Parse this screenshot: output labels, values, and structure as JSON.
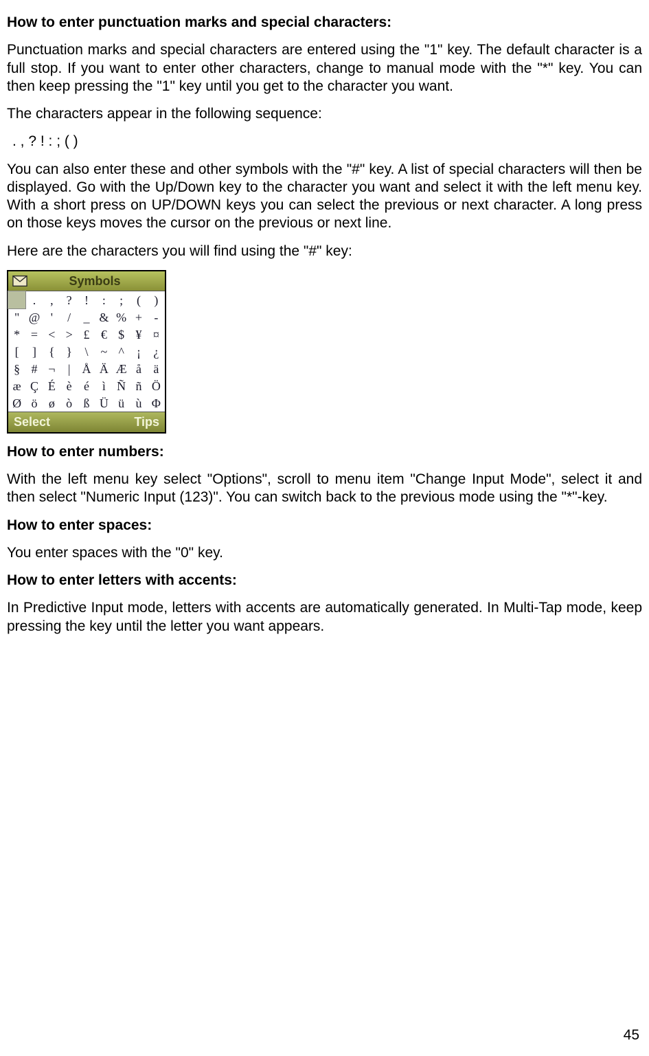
{
  "sections": {
    "punct_heading": "How to enter punctuation marks and special characters:",
    "punct_para1": "Punctuation marks and special characters are entered using the \"1\" key. The default character is a full stop. If you want to enter other characters, change to manual mode with the \"*\" key. You can then keep pressing the \"1\" key until you get to the character you want.",
    "seq_intro": "The characters appear in the following sequence:",
    "seq": ". , ? ! : ; ( )",
    "punct_para2": "You can also enter these and other symbols with the \"#\" key. A list of special characters will then be displayed. Go with the Up/Down key to the character you want and select it with the left menu key. With a short press on UP/DOWN keys you can select the previous or next character. A long press on those keys moves the cursor on the previous or next line.",
    "hash_intro": "Here are the characters you will find using the \"#\" key:",
    "numbers_heading": "How to enter numbers:",
    "numbers_para": "With the left menu key select \"Options\", scroll to menu item \"Change Input Mode\", select it and then select \"Numeric Input (123)\". You can switch back to the previous mode using the \"*\"-key.",
    "spaces_heading": "How to enter spaces:",
    "spaces_para": "You enter spaces with the \"0\" key.",
    "accents_heading": "How to enter letters with accents:",
    "accents_para": "In Predictive Input mode, letters with accents are automatically generated. In Multi-Tap mode, keep pressing the key until the letter you want appears."
  },
  "phone": {
    "title": "Symbols",
    "softkeys": {
      "left": "Select",
      "right": "Tips"
    },
    "grid": [
      [
        "",
        ".",
        ",",
        "?",
        "!",
        ":",
        ";",
        "(",
        ")"
      ],
      [
        "\"",
        "@",
        "'",
        "/",
        "_",
        "&",
        "%",
        "+",
        "-"
      ],
      [
        "*",
        "=",
        "<",
        ">",
        "£",
        "€",
        "$",
        "¥",
        "¤"
      ],
      [
        "[",
        "]",
        "{",
        "}",
        "\\",
        "~",
        "^",
        "¡",
        "¿"
      ],
      [
        "§",
        "#",
        "¬",
        "|",
        "Å",
        "Ä",
        "Æ",
        "å",
        "ä"
      ],
      [
        "æ",
        "Ç",
        "É",
        "è",
        "é",
        "ì",
        "Ñ",
        "ñ",
        "Ö"
      ],
      [
        "Ø",
        "ö",
        "ø",
        "ò",
        "ß",
        "Ü",
        "ü",
        "ù",
        "Φ"
      ]
    ]
  },
  "page_number": "45"
}
